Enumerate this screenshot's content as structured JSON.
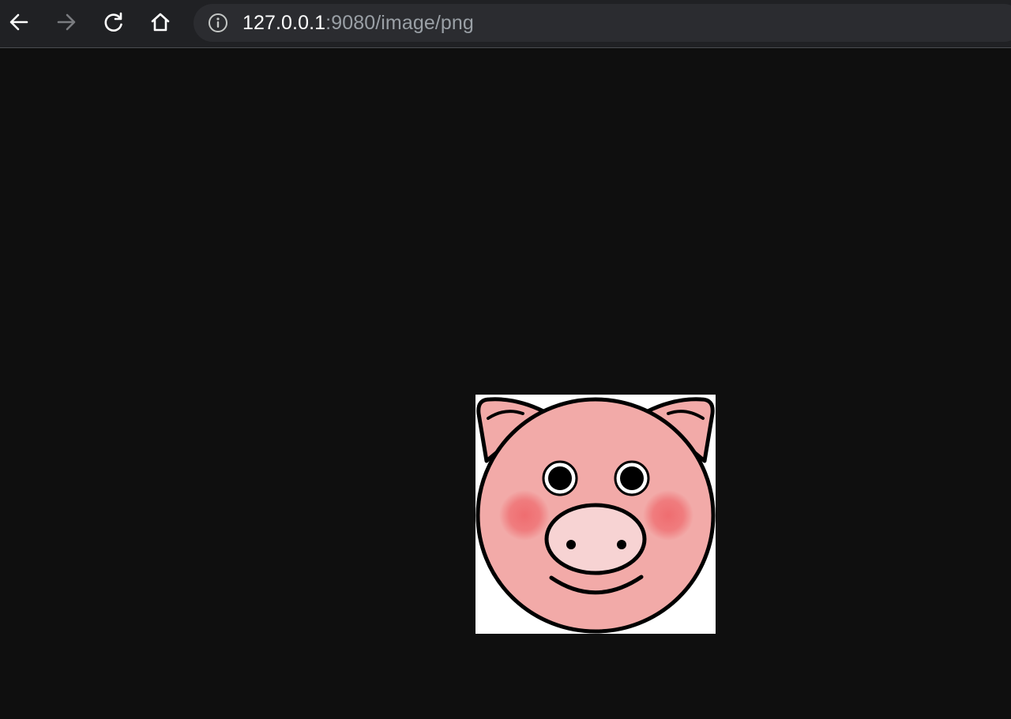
{
  "browser": {
    "url_host": "127.0.0.1",
    "url_path": ":9080/image/png",
    "icons": {
      "back": "arrow-left-icon",
      "forward": "arrow-right-icon",
      "reload": "reload-icon",
      "home": "home-icon",
      "site_info": "info-circle-icon"
    },
    "colors": {
      "toolbar": "#202124",
      "omnibox": "#2b2c30",
      "page_background": "#0f0f0f"
    }
  },
  "content": {
    "image": {
      "subject": "pig-face",
      "colors": {
        "face": "#f2aaa8",
        "snout": "#f7d3d3",
        "cheek": "#ef6d70",
        "outline": "#000000",
        "background": "#ffffff"
      }
    }
  }
}
